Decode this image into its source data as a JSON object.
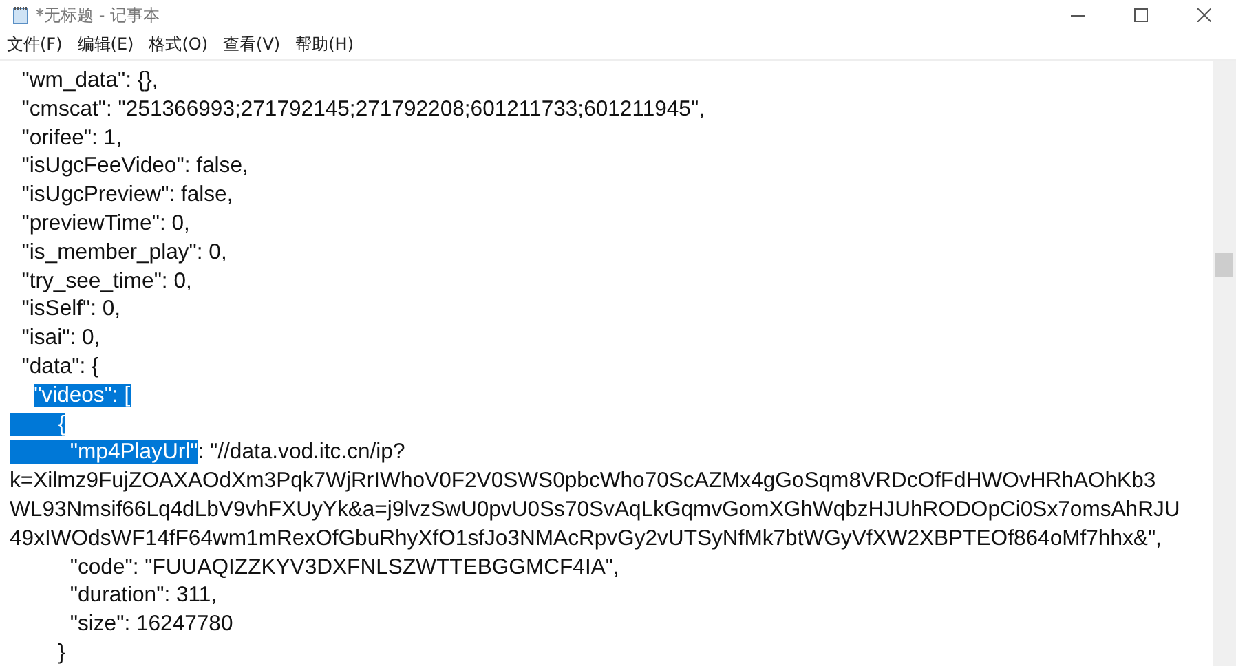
{
  "window": {
    "title": "*无标题 - 记事本"
  },
  "menu": [
    "文件(F)",
    "编辑(E)",
    "格式(O)",
    "查看(V)",
    "帮助(H)"
  ],
  "lines": [
    [
      {
        "text": "  \"wm_data\": {},",
        "selected": false
      }
    ],
    [
      {
        "text": "  \"cmscat\": \"251366993;271792145;271792208;601211733;601211945\",",
        "selected": false
      }
    ],
    [
      {
        "text": "  \"orifee\": 1,",
        "selected": false
      }
    ],
    [
      {
        "text": "  \"isUgcFeeVideo\": false,",
        "selected": false
      }
    ],
    [
      {
        "text": "  \"isUgcPreview\": false,",
        "selected": false
      }
    ],
    [
      {
        "text": "  \"previewTime\": 0,",
        "selected": false
      }
    ],
    [
      {
        "text": "  \"is_member_play\": 0,",
        "selected": false
      }
    ],
    [
      {
        "text": "  \"try_see_time\": 0,",
        "selected": false
      }
    ],
    [
      {
        "text": "  \"isSelf\": 0,",
        "selected": false
      }
    ],
    [
      {
        "text": "  \"isai\": 0,",
        "selected": false
      }
    ],
    [
      {
        "text": "  \"data\": {",
        "selected": false
      }
    ],
    [
      {
        "text": "    \"videos\": [",
        "selected": true,
        "indent_unselected": true
      }
    ],
    [
      {
        "text": "        {",
        "selected": true
      }
    ],
    [
      {
        "text": "          \"mp4PlayUrl\"",
        "selected": true
      },
      {
        "text": ": \"//data.vod.itc.cn/ip?",
        "selected": false
      }
    ],
    [
      {
        "text": "k=Xilmz9FujZOAXAOdXm3Pqk7WjRrIWhoV0F2V0SWS0pbcWho70ScAZMx4gGoSqm8VRDcOfFdHWOvHRhAOhKb3",
        "selected": false
      }
    ],
    [
      {
        "text": "WL93Nmsif66Lq4dLbV9vhFXUyYk&a=j9lvzSwU0pvU0Ss70SvAqLkGqmvGomXGhWqbzHJUhRODOpCi0Sx7omsAhRJU",
        "selected": false
      }
    ],
    [
      {
        "text": "49xIWOdsWF14fF64wm1mRexOfGbuRhyXfO1sfJo3NMAcRpvGy2vUTSyNfMk7btWGyVfXW2XBPTEOf864oMf7hhx&\",",
        "selected": false
      }
    ],
    [
      {
        "text": "          \"code\": \"FUUAQIZZKYV3DXFNLSZWTTEBGGMCF4IA\",",
        "selected": false
      }
    ],
    [
      {
        "text": "          \"duration\": 311,",
        "selected": false
      }
    ],
    [
      {
        "text": "          \"size\": 16247780",
        "selected": false
      }
    ],
    [
      {
        "text": "        }",
        "selected": false
      }
    ]
  ]
}
